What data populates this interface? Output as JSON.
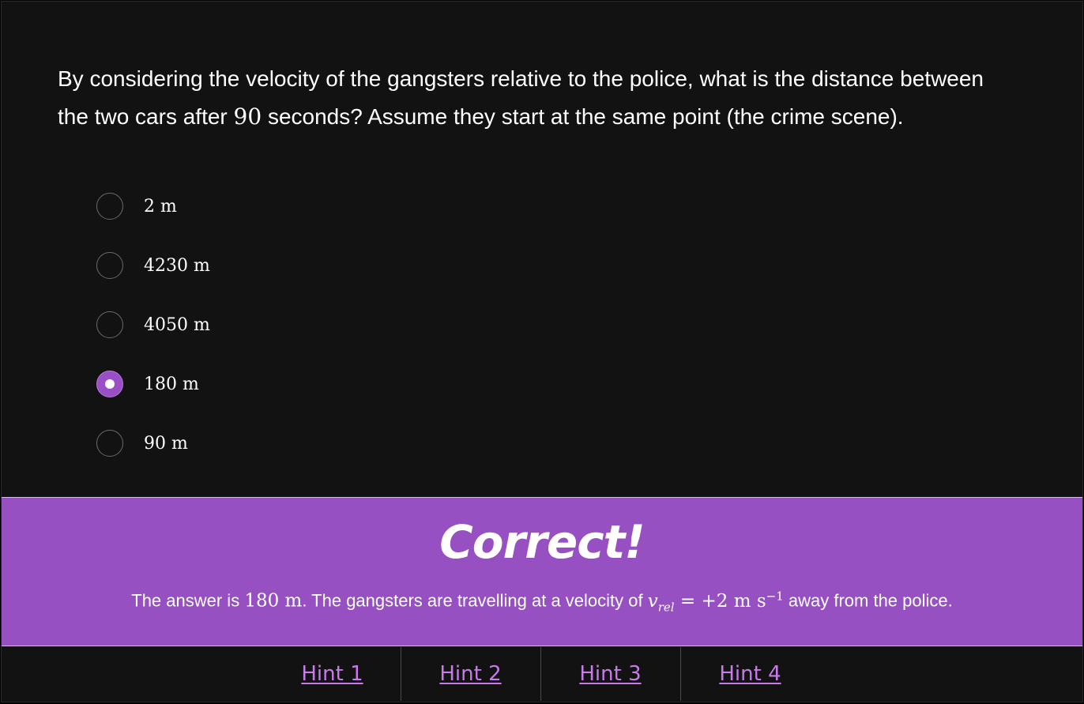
{
  "question": {
    "text_before": "By considering the velocity of the gangsters relative to the police, what is the distance between the two cars after ",
    "math": "90",
    "text_after": " seconds? Assume they start at the same point (the crime scene)."
  },
  "options": [
    {
      "label": "2 m",
      "selected": false
    },
    {
      "label": "4230 m",
      "selected": false
    },
    {
      "label": "4050 m",
      "selected": false
    },
    {
      "label": "180 m",
      "selected": true
    },
    {
      "label": "90 m",
      "selected": false
    }
  ],
  "feedback": {
    "title": "Correct!",
    "text_1": "The answer is ",
    "math_1": "180 m",
    "text_2": ". The gangsters are travelling at a velocity of ",
    "math_2": "v",
    "math_2_sub": "rel",
    "math_3": " = +2 m s",
    "math_3_sup": "−1",
    "text_3": " away from the police.",
    "background_color": "#9650c2"
  },
  "hints": [
    {
      "label": "Hint 1"
    },
    {
      "label": "Hint 2"
    },
    {
      "label": "Hint 3"
    },
    {
      "label": "Hint 4"
    }
  ],
  "colors": {
    "background": "#121212",
    "accent": "#9a4fc6",
    "hint_link": "#c67be8"
  }
}
